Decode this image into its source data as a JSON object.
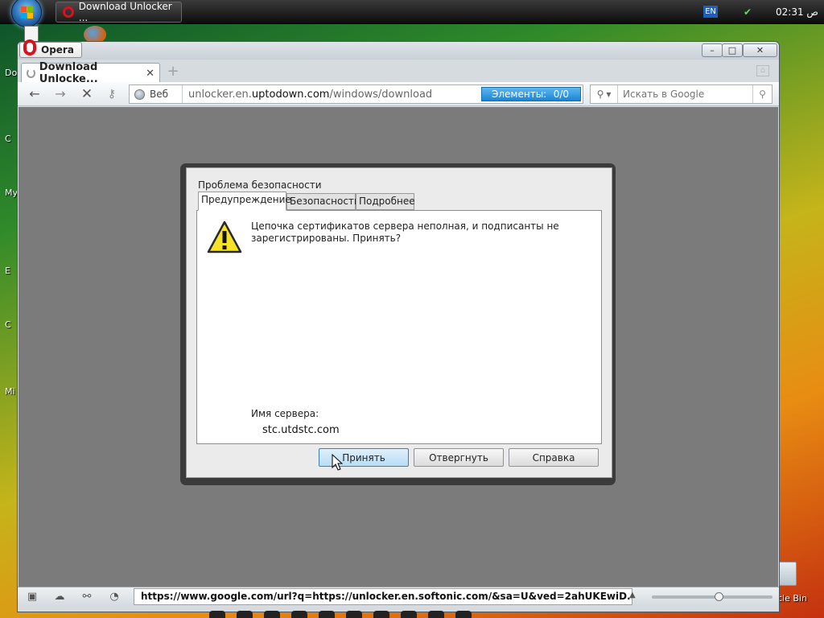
{
  "taskbar": {
    "task_title": "Download Unlocker ...",
    "language": "EN",
    "clock": "02:31 ص"
  },
  "desktop": {
    "side_letters": [
      "Do",
      "C",
      "My",
      "E",
      "C",
      "Mi"
    ],
    "recycle_label": "cle Bin"
  },
  "browser": {
    "menu_label": "Opera",
    "window_controls": {
      "minimize": "–",
      "maximize": "□",
      "close": "✕"
    },
    "tab": {
      "title": "Download Unlocke...",
      "close": "✕",
      "new_tab": "+"
    },
    "nav": {
      "back": "←",
      "forward": "→",
      "stop": "✕",
      "key": "⚷"
    },
    "address": {
      "web_label": "Веб",
      "url_prefix": "unlocker.en.",
      "url_domain": "uptodown.com",
      "url_path": "/windows/download",
      "elements_label": "Элементы:",
      "elements_value": "0/0"
    },
    "search": {
      "placeholder": "Искать в Google"
    },
    "status": {
      "link_url": "https://www.google.com/url?q=https://unlocker.en.softonic.com/&sa=U&ved=2ahUKEwiD...",
      "zoom_fraction": 0.56
    }
  },
  "dialog": {
    "title": "Проблема безопасности",
    "tabs": [
      "Предупреждение",
      "Безопасность",
      "Подробнее"
    ],
    "message": "Цепочка сертификатов сервера неполная, и подписанты не зарегистрированы. Принять?",
    "server_label": "Имя сервера:",
    "server_value": "stc.utdstc.com",
    "buttons": {
      "accept": "Принять",
      "reject": "Отвергнуть",
      "help": "Справка"
    }
  },
  "colors": {
    "opera_red": "#d8121e",
    "progress_blue": "#1a85d4",
    "page_background": "#7b7b7b"
  }
}
